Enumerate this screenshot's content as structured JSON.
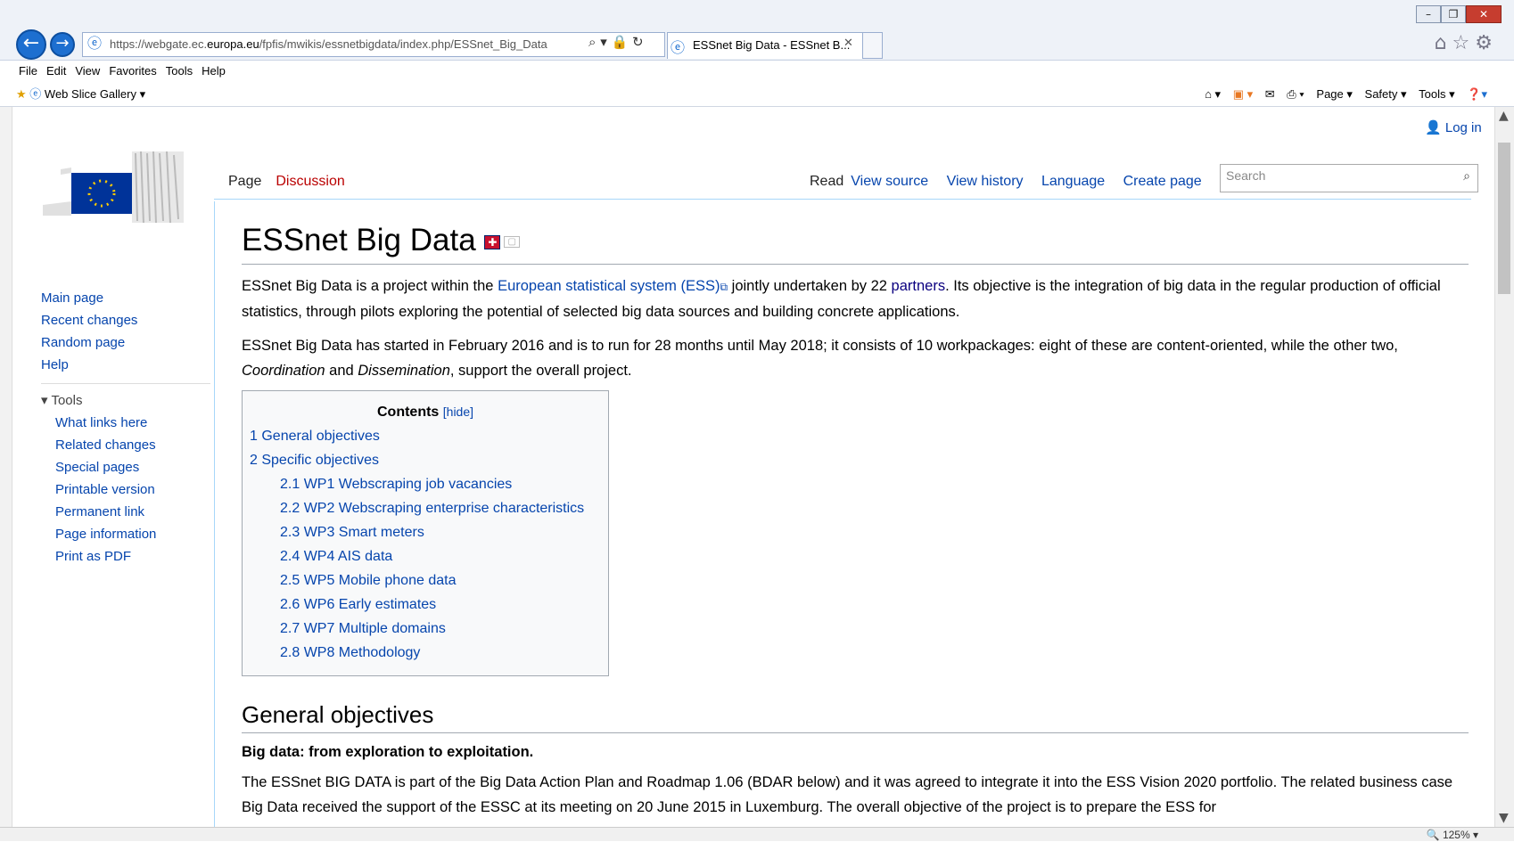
{
  "browser": {
    "url_prefix": "https://webgate.ec.",
    "url_domain": "europa.eu",
    "url_path": "/fpfis/mwikis/essnetbigdata/index.php/ESSnet_Big_Data",
    "tab_title": "ESSnet Big Data - ESSnet B...",
    "menu": [
      "File",
      "Edit",
      "View",
      "Favorites",
      "Tools",
      "Help"
    ],
    "favorites_bar": "Web Slice Gallery ▾",
    "cmd": [
      "Page ▾",
      "Safety ▾",
      "Tools ▾"
    ],
    "zoom": "🔍 125% ▾"
  },
  "wiki": {
    "login": "Log in",
    "nav": [
      "Main page",
      "Recent changes",
      "Random page",
      "Help"
    ],
    "tools_heading": "Tools",
    "tools": [
      "What links here",
      "Related changes",
      "Special pages",
      "Printable version",
      "Permanent link",
      "Page information",
      "Print as PDF"
    ],
    "page_tabs": {
      "page": "Page",
      "discussion": "Discussion",
      "read": "Read",
      "view_source": "View source",
      "view_history": "View history",
      "language": "Language",
      "create_page": "Create page"
    },
    "search_placeholder": "Search",
    "title": "ESSnet Big Data",
    "para1_a": "ESSnet Big Data is a project within the ",
    "para1_link": "European statistical system (ESS)",
    "para1_b": " jointly undertaken by 22 ",
    "para1_link2": "partners",
    "para1_c": ". Its objective is the integration of big data in the regular production of official statistics, through pilots exploring the potential of selected big data sources and building concrete applications.",
    "para2_a": "ESSnet Big Data has started in February 2016 and is to run for 28 months until May 2018; it consists of 10 workpackages: eight of these are content-oriented, while the other two, ",
    "para2_i1": "Coordination",
    "para2_b": " and ",
    "para2_i2": "Dissemination",
    "para2_c": ", support the overall project.",
    "toc_title": "Contents",
    "toc_hide": "[hide]",
    "toc_items": [
      {
        "label": "1 General objectives",
        "level": 1
      },
      {
        "label": "2 Specific objectives",
        "level": 1
      },
      {
        "label": "2.1 WP1 Webscraping job vacancies",
        "level": 2
      },
      {
        "label": "2.2 WP2 Webscraping enterprise characteristics",
        "level": 2
      },
      {
        "label": "2.3 WP3 Smart meters",
        "level": 2
      },
      {
        "label": "2.4 WP4 AIS data",
        "level": 2
      },
      {
        "label": "2.5 WP5 Mobile phone data",
        "level": 2
      },
      {
        "label": "2.6 WP6 Early estimates",
        "level": 2
      },
      {
        "label": "2.7 WP7 Multiple domains",
        "level": 2
      },
      {
        "label": "2.8 WP8 Methodology",
        "level": 2
      }
    ],
    "h2_general": "General objectives",
    "subheading": "Big data: from exploration to exploitation.",
    "para3": "The ESSnet BIG DATA is part of the Big Data Action Plan and Roadmap 1.06 (BDAR below) and it was agreed to integrate it into the ESS Vision 2020 portfolio. The related business case Big Data received the support of the ESSC at its meeting on 20 June 2015 in Luxemburg. The overall objective of the project is to prepare the ESS for"
  }
}
